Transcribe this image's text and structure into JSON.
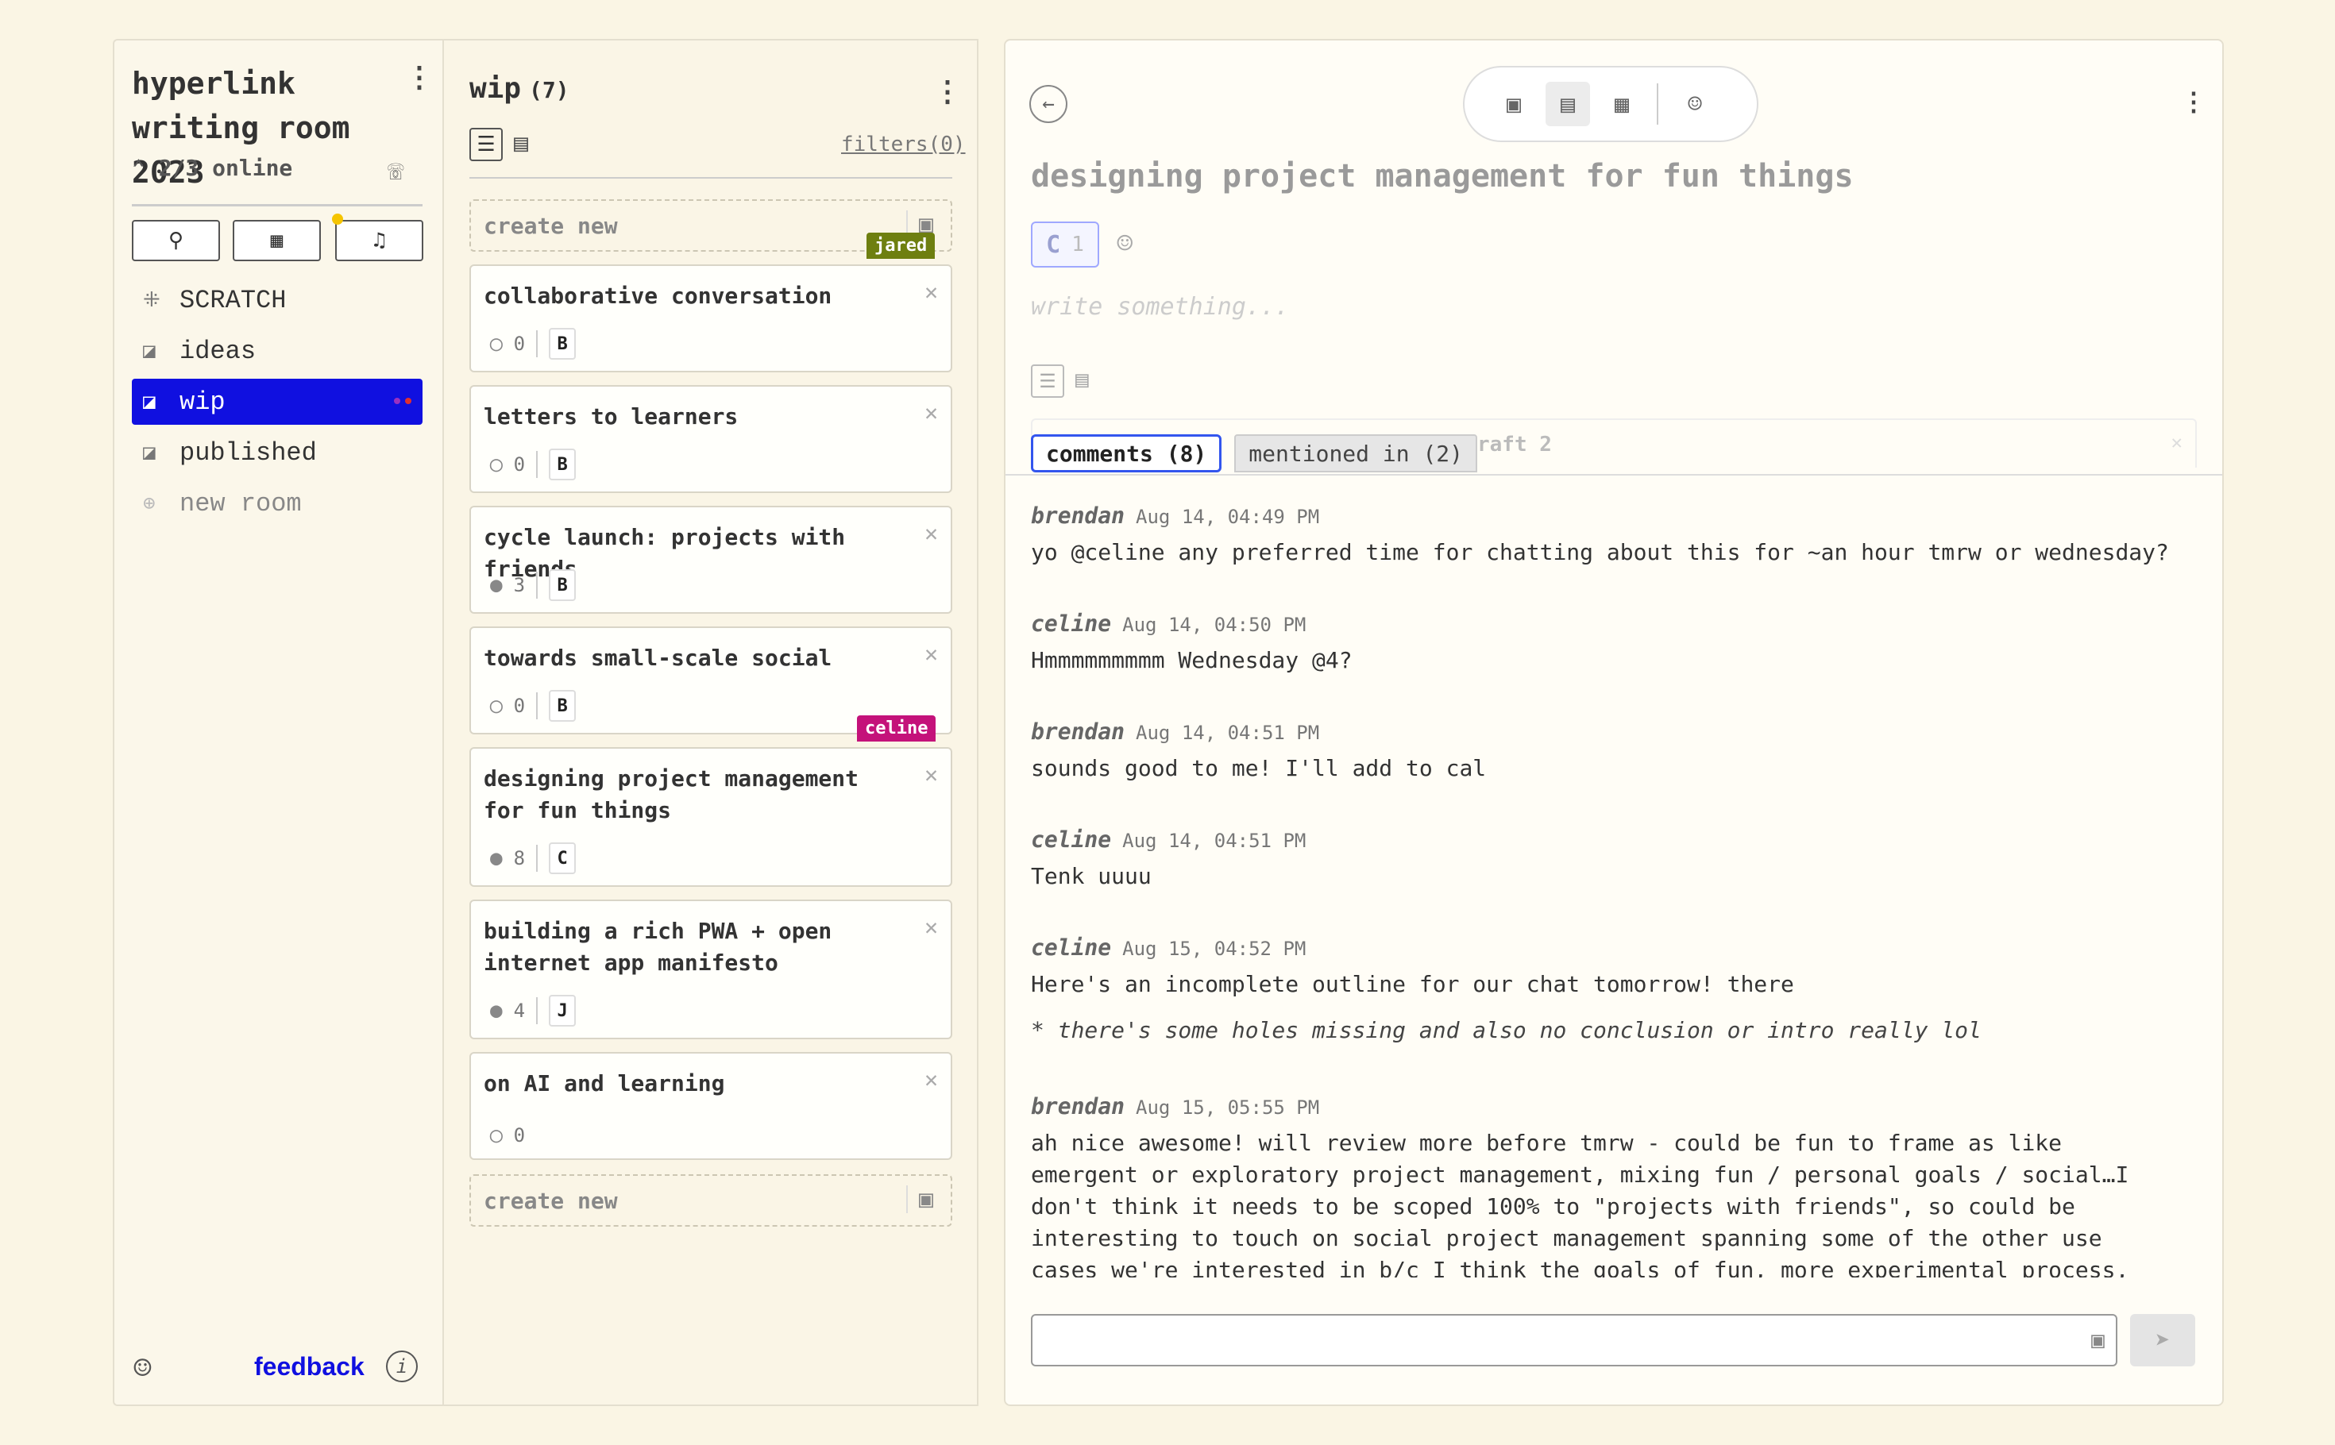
{
  "sidebar": {
    "room_title": "hyperlink writing room 2023",
    "online": "2/3 online",
    "items": [
      {
        "label": "SCRATCH",
        "icon": "grid-icon"
      },
      {
        "label": "ideas",
        "icon": "stack-icon"
      },
      {
        "label": "wip",
        "icon": "stack-icon"
      },
      {
        "label": "published",
        "icon": "stack-icon"
      },
      {
        "label": "new room",
        "icon": "plus-circle-icon"
      }
    ],
    "feedback": "feedback"
  },
  "list": {
    "title": "wip",
    "count": "(7)",
    "filters": "filters(0)",
    "create_new": "create new",
    "cards": [
      {
        "title": "collaborative conversation",
        "comments": "0",
        "badge": "B"
      },
      {
        "title": "letters to learners",
        "comments": "0",
        "badge": "B"
      },
      {
        "title": "cycle launch: projects with friends",
        "comments": "3",
        "badge": "B"
      },
      {
        "title": "towards small-scale social",
        "comments": "0",
        "badge": "B"
      },
      {
        "title": "designing project management for fun things",
        "comments": "8",
        "badge": "C"
      },
      {
        "title": "building a rich PWA + open internet app manifesto",
        "comments": "4",
        "badge": "J"
      },
      {
        "title": "on AI and learning",
        "comments": "0",
        "badge": ""
      }
    ],
    "user_tags": [
      {
        "name": "jared",
        "color": "#6e7f10"
      },
      {
        "name": "celine",
        "color": "#c4127a"
      }
    ]
  },
  "detail": {
    "title": "designing project management for fun things",
    "tag_letter": "C",
    "tag_count": "1",
    "placeholder": "write something...",
    "hidden_ref": "raft 2",
    "tabs": {
      "comments": "comments (8)",
      "mentioned": "mentioned in (2)"
    },
    "comments": [
      {
        "author": "brendan",
        "time": "Aug 14, 04:49 PM",
        "body": "yo @celine any preferred time for chatting about this for ~an hour tmrw or wednesday?"
      },
      {
        "author": "celine",
        "time": "Aug 14, 04:50 PM",
        "body": "Hmmmmmmmmm Wednesday @4?"
      },
      {
        "author": "brendan",
        "time": "Aug 14, 04:51 PM",
        "body": "sounds good to me! I'll add to cal"
      },
      {
        "author": "celine",
        "time": "Aug 14, 04:51 PM",
        "body": "Tenk uuuu"
      },
      {
        "author": "celine",
        "time": "Aug 15, 04:52 PM",
        "body": "Here's an incomplete outline for our chat tomorrow! there",
        "body2": "* there's some holes missing and also no conclusion or intro really lol"
      },
      {
        "author": "brendan",
        "time": "Aug 15, 05:55 PM",
        "body": "ah nice awesome! will review more before tmrw - could be fun to frame as like emergent or exploratory project management, mixing fun / personal goals / social…I don't think it needs to be scoped 100% to \"projects with friends\", so could be interesting to touch on social project management spanning some of the other use cases we're interested in b/c I think the goals of fun, more experimental process, evolution over time etc. could apply in other areas (tho maybe better w/ some focus)"
      }
    ]
  },
  "colors": {
    "accent": "#1010e0",
    "tab_border": "#3355ee",
    "background": "#faf5e4"
  }
}
